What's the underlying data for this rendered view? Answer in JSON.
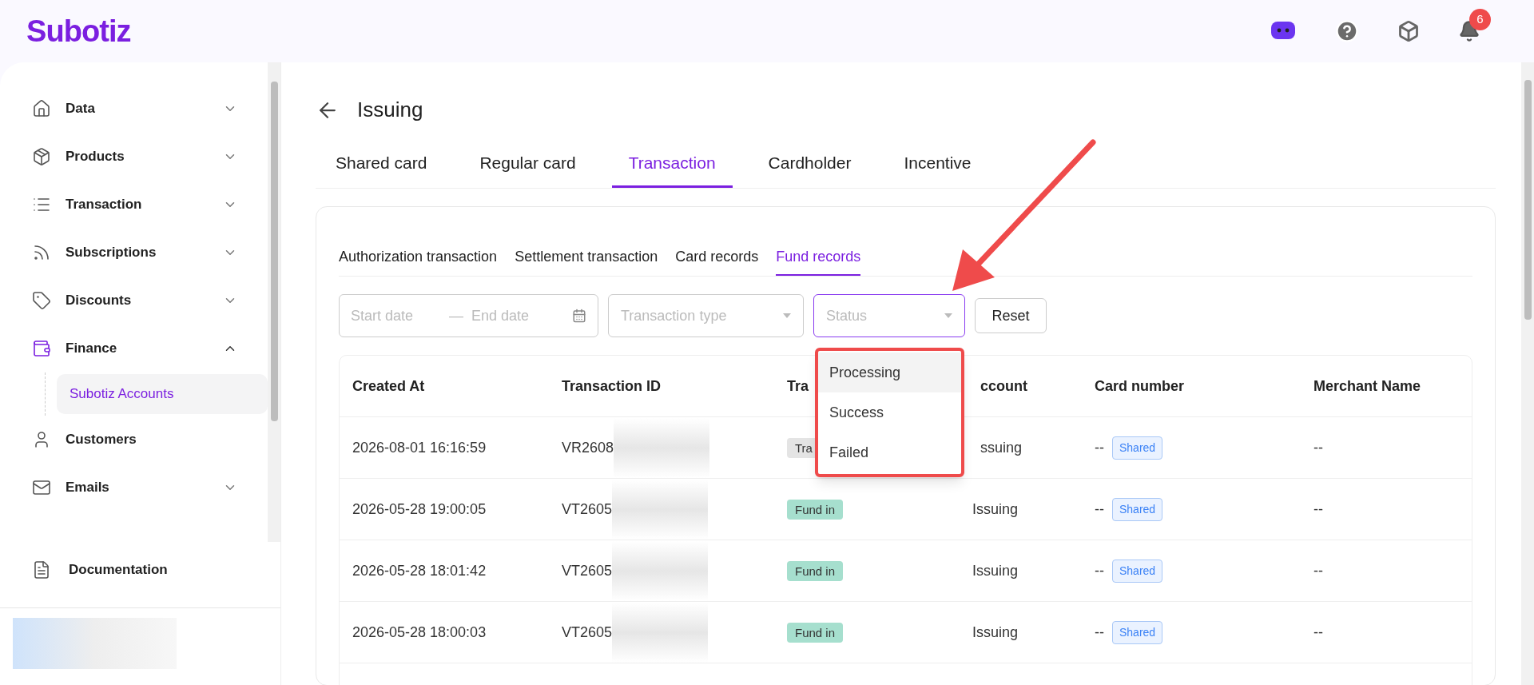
{
  "brand": "Subotiz",
  "header": {
    "notification_count": "6"
  },
  "sidebar": {
    "items": [
      {
        "label": "Data",
        "expanded": false
      },
      {
        "label": "Products",
        "expanded": false
      },
      {
        "label": "Transaction",
        "expanded": false
      },
      {
        "label": "Subscriptions",
        "expanded": false
      },
      {
        "label": "Discounts",
        "expanded": false
      },
      {
        "label": "Finance",
        "expanded": true,
        "children": [
          {
            "label": "Subotiz Accounts",
            "selected": true
          }
        ]
      },
      {
        "label": "Customers"
      },
      {
        "label": "Emails",
        "expanded": false
      }
    ],
    "footer_link": "Documentation"
  },
  "page": {
    "title": "Issuing",
    "tabs": [
      {
        "label": "Shared card",
        "selected": false
      },
      {
        "label": "Regular card",
        "selected": false
      },
      {
        "label": "Transaction",
        "selected": true
      },
      {
        "label": "Cardholder",
        "selected": false
      },
      {
        "label": "Incentive",
        "selected": false
      }
    ],
    "subtabs": [
      {
        "label": "Authorization transaction",
        "selected": false
      },
      {
        "label": "Settlement transaction",
        "selected": false
      },
      {
        "label": "Card records",
        "selected": false
      },
      {
        "label": "Fund records",
        "selected": true
      }
    ],
    "filters": {
      "start_placeholder": "Start date",
      "separator": "—",
      "end_placeholder": "End date",
      "type_placeholder": "Transaction type",
      "status": {
        "placeholder": "Status",
        "focused": true,
        "options": [
          {
            "label": "Processing",
            "highlighted": true
          },
          {
            "label": "Success",
            "highlighted": false
          },
          {
            "label": "Failed",
            "highlighted": false
          }
        ]
      },
      "reset": "Reset"
    },
    "table": {
      "columns": [
        "Created At",
        "Transaction ID",
        "Tra",
        "ccount",
        "Card number",
        "Merchant Name"
      ],
      "rows": [
        {
          "created_at": "2026-08-01 16:16:59",
          "transaction_id": "VR2608",
          "type": {
            "label": "Tra",
            "color": "#e4e4e4"
          },
          "account": "ssuing",
          "card_number": "--",
          "card_tag": "Shared",
          "merchant": "--"
        },
        {
          "created_at": "2026-05-28 19:00:05",
          "transaction_id": "VT2605",
          "type": {
            "label": "Fund in",
            "color": "#a6dfce"
          },
          "account": "Issuing",
          "card_number": "--",
          "card_tag": "Shared",
          "merchant": "--"
        },
        {
          "created_at": "2026-05-28 18:01:42",
          "transaction_id": "VT2605",
          "type": {
            "label": "Fund in",
            "color": "#a6dfce"
          },
          "account": "Issuing",
          "card_number": "--",
          "card_tag": "Shared",
          "merchant": "--"
        },
        {
          "created_at": "2026-05-28 18:00:03",
          "transaction_id": "VT2605",
          "type": {
            "label": "Fund in",
            "color": "#a6dfce"
          },
          "account": "Issuing",
          "card_number": "--",
          "card_tag": "Shared",
          "merchant": "--"
        }
      ]
    }
  }
}
